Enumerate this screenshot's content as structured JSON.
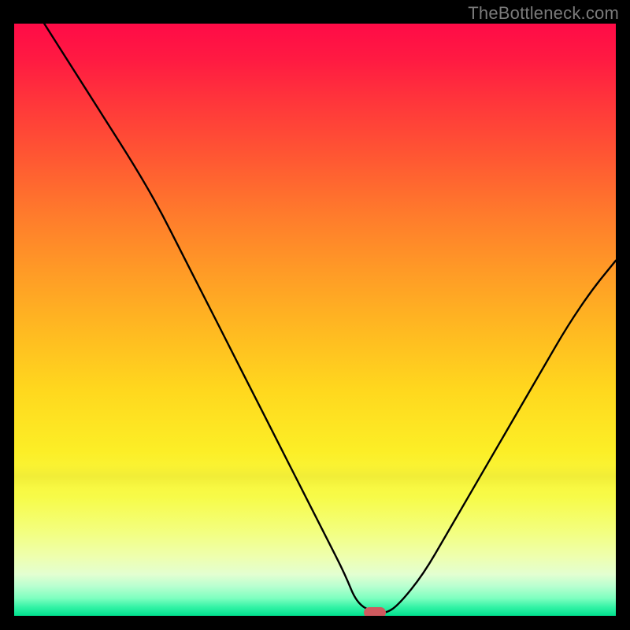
{
  "watermark": "TheBottleneck.com",
  "colors": {
    "frame": "#000000",
    "curve": "#000000",
    "marker": "#cf5a5f",
    "text": "#7a7a7a"
  },
  "chart_data": {
    "type": "line",
    "title": "",
    "xlabel": "",
    "ylabel": "",
    "xlim": [
      0,
      100
    ],
    "ylim": [
      0,
      100
    ],
    "grid": false,
    "legend": false,
    "note": "No axis ticks visible; values estimated from pixel positions on a 0–100 normalized scale. y=0 is bottom (green), y=100 is top (red). Curve descends from top-left, flattens near x≈57–62 at y≈0, then rises toward upper right.",
    "series": [
      {
        "name": "bottleneck-curve",
        "x": [
          5,
          10,
          15,
          20,
          24,
          28,
          32,
          36,
          40,
          44,
          48,
          52,
          55,
          57,
          60,
          62,
          64,
          68,
          72,
          76,
          80,
          84,
          88,
          92,
          96,
          100
        ],
        "y": [
          100,
          92,
          84,
          76,
          69,
          61,
          53,
          45,
          37,
          29,
          21,
          13,
          7,
          2,
          0.5,
          0.5,
          2,
          7,
          14,
          21,
          28,
          35,
          42,
          49,
          55,
          60
        ]
      }
    ],
    "marker": {
      "x": 60,
      "y": 0.5,
      "shape": "rounded-rect"
    },
    "gradient_stops": [
      {
        "pos": 0.0,
        "color": "#ff0b47"
      },
      {
        "pos": 0.22,
        "color": "#ff5533"
      },
      {
        "pos": 0.52,
        "color": "#ffba21"
      },
      {
        "pos": 0.8,
        "color": "#f7fb49"
      },
      {
        "pos": 0.93,
        "color": "#e3ffd1"
      },
      {
        "pos": 1.0,
        "color": "#00e18e"
      }
    ]
  }
}
